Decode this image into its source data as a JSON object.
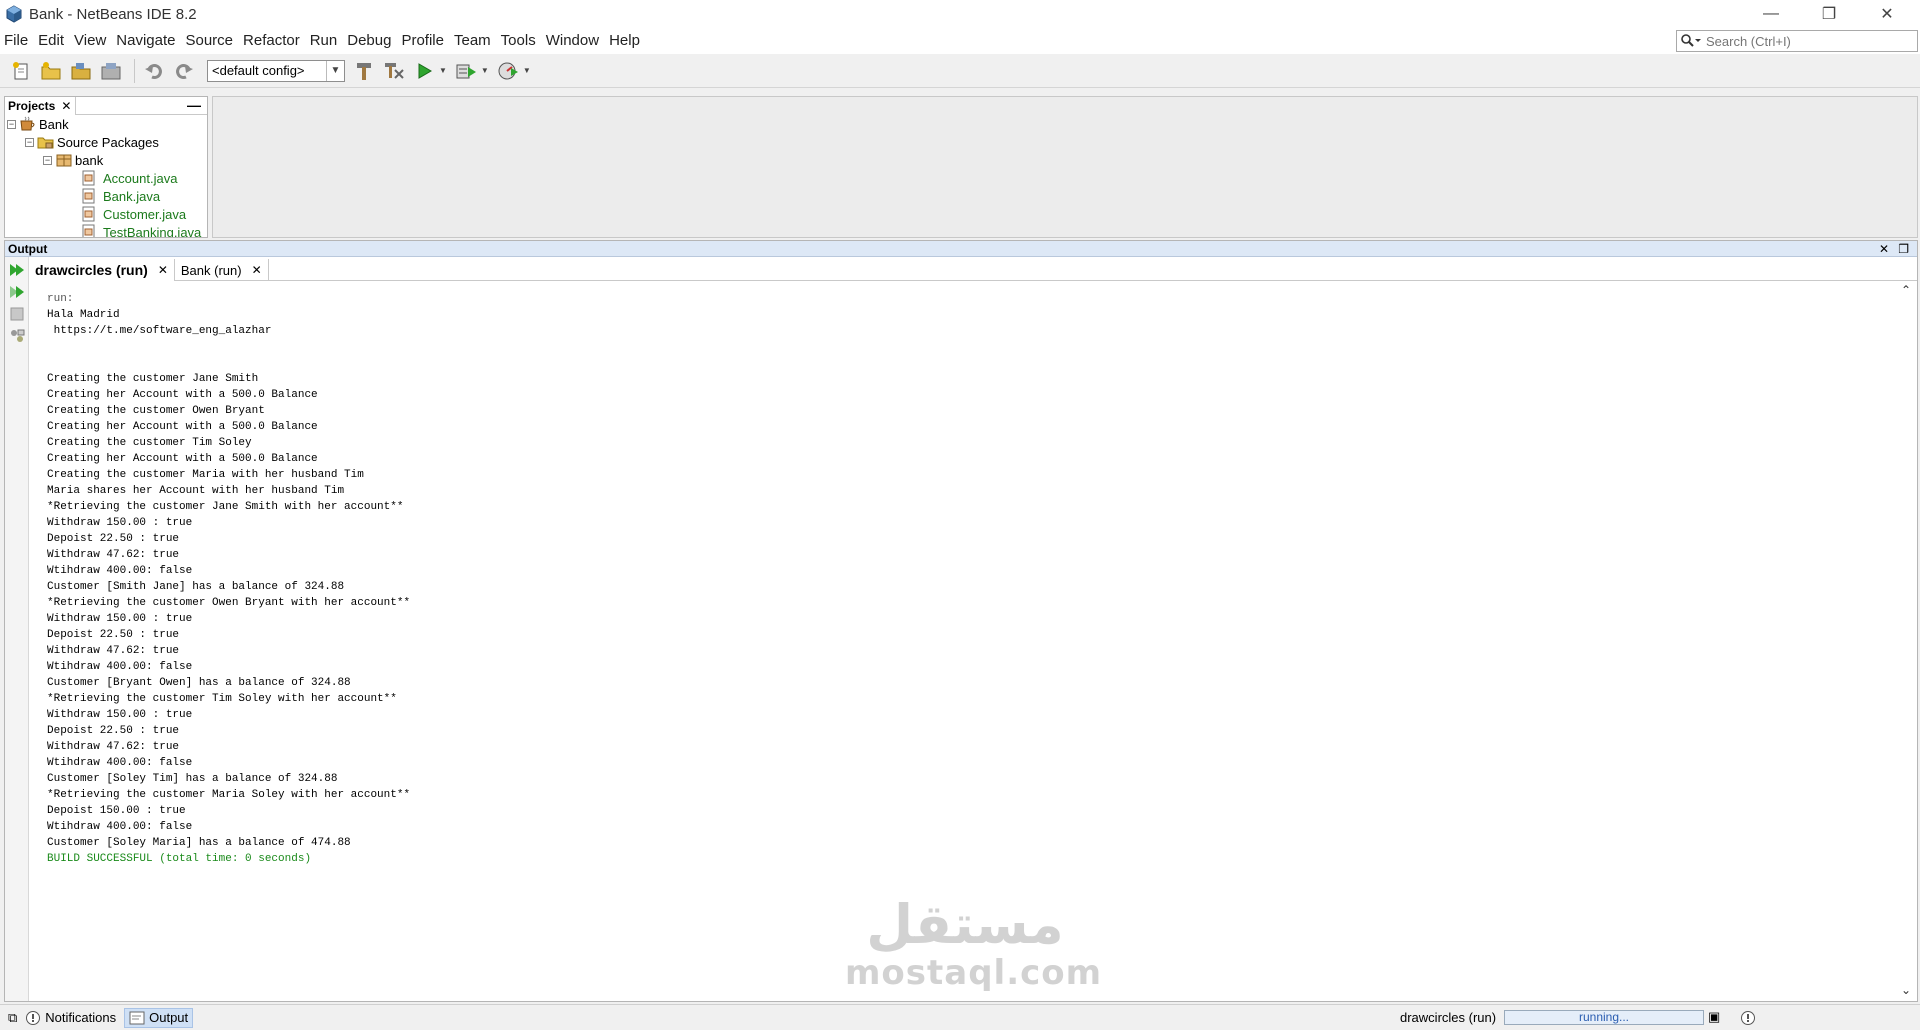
{
  "window": {
    "title": "Bank - NetBeans IDE 8.2",
    "controls": {
      "minimize": "—",
      "restore": "❐",
      "close": "✕"
    }
  },
  "menu": [
    "File",
    "Edit",
    "View",
    "Navigate",
    "Source",
    "Refactor",
    "Run",
    "Debug",
    "Profile",
    "Team",
    "Tools",
    "Window",
    "Help"
  ],
  "search": {
    "placeholder": "Search (Ctrl+I)"
  },
  "toolbar": {
    "config_value": "<default config>",
    "icons": [
      "new-file-icon",
      "new-project-icon",
      "open-project-icon",
      "close-project-icon",
      "undo-icon",
      "redo-icon",
      "build-icon",
      "clean-build-icon",
      "run-icon",
      "debug-icon",
      "profile-icon"
    ]
  },
  "projects": {
    "tab_label": "Projects",
    "close": "✕",
    "minimize": "—",
    "tree": {
      "root": "Bank",
      "source_packages": "Source Packages",
      "package": "bank",
      "files": [
        "Account.java",
        "Bank.java",
        "Customer.java",
        "TestBanking.java"
      ]
    }
  },
  "output": {
    "title": "Output",
    "close": "✕",
    "restore": "❐",
    "tabs": [
      {
        "label": "drawcircles (run)",
        "close": "✕"
      },
      {
        "label": "Bank (run)",
        "close": "✕"
      }
    ],
    "lines": [
      "run:",
      "Hala Madrid",
      " https://t.me/software_eng_alazhar",
      "",
      "",
      "Creating the customer Jane Smith",
      "Creating her Account with a 500.0 Balance",
      "Creating the customer Owen Bryant",
      "Creating her Account with a 500.0 Balance",
      "Creating the customer Tim Soley",
      "Creating her Account with a 500.0 Balance",
      "Creating the customer Maria with her husband Tim",
      "Maria shares her Account with her husband Tim",
      "*Retrieving the customer Jane Smith with her account**",
      "Withdraw 150.00 : true",
      "Depoist 22.50 : true",
      "Withdraw 47.62: true",
      "Wtihdraw 400.00: false",
      "Customer [Smith Jane] has a balance of 324.88",
      "*Retrieving the customer Owen Bryant with her account**",
      "Withdraw 150.00 : true",
      "Depoist 22.50 : true",
      "Withdraw 47.62: true",
      "Wtihdraw 400.00: false",
      "Customer [Bryant Owen] has a balance of 324.88",
      "*Retrieving the customer Tim Soley with her account**",
      "Withdraw 150.00 : true",
      "Depoist 22.50 : true",
      "Withdraw 47.62: true",
      "Wtihdraw 400.00: false",
      "Customer [Soley Tim] has a balance of 324.88",
      "*Retrieving the customer Maria Soley with her account**",
      "Depoist 150.00 : true",
      "Wtihdraw 400.00: false",
      "Customer [Soley Maria] has a balance of 474.88",
      "BUILD SUCCESSFUL (total time: 0 seconds)"
    ]
  },
  "watermark": {
    "arabic": "مستقل",
    "latin": "mostaql.com"
  },
  "status": {
    "notifications": "Notifications",
    "output": "Output",
    "task": "drawcircles (run)",
    "progress_text": "running..."
  },
  "colors": {
    "build_success": "#1a8a1a",
    "java_file": "#1c7a1c",
    "output_header": "#dde8f6"
  }
}
